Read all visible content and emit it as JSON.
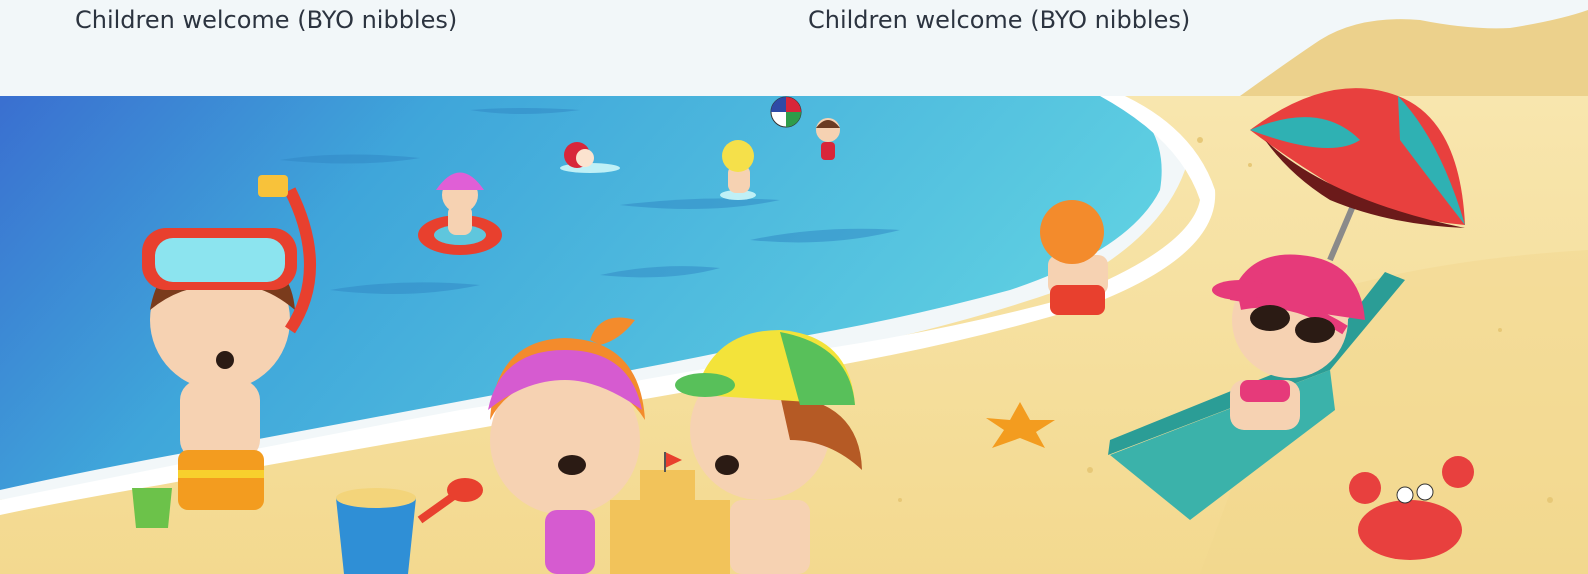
{
  "notes": {
    "left": "Children welcome (BYO nibbles)",
    "right": "Children welcome (BYO nibbles)"
  },
  "colors": {
    "background": "#f2f7f9",
    "sea_deep": "#3a7fd0",
    "sea_light": "#59c7e0",
    "sand": "#f7e2a4",
    "foam": "#ffffff",
    "text": "#2c3440"
  },
  "scene": {
    "illustration": "beach-scene-illustration"
  }
}
